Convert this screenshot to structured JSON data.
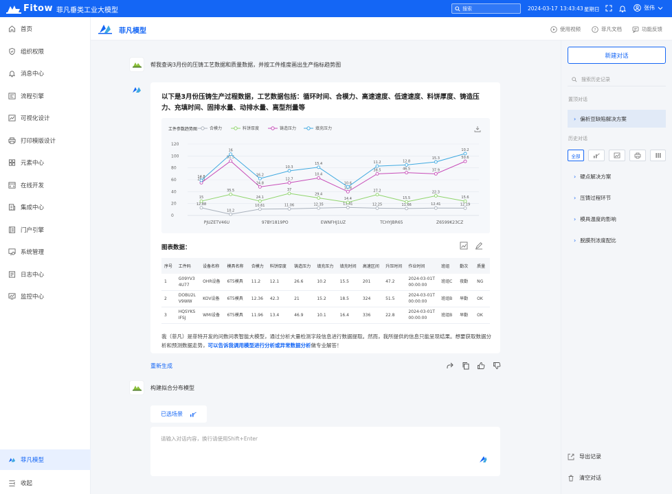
{
  "topbar": {
    "logo_text": "Fitow",
    "app_title": "菲凡垂类工业大模型",
    "search_placeholder": "搜索",
    "date": "2024-03-17",
    "time": "13:43:43",
    "weekday": "星期日",
    "username": "张伟"
  },
  "sidebar": {
    "items": [
      {
        "label": "首页",
        "icon": "home-icon"
      },
      {
        "label": "组织权限",
        "icon": "shield-icon"
      },
      {
        "label": "消息中心",
        "icon": "bell-icon"
      },
      {
        "label": "流程引擎",
        "icon": "flow-icon"
      },
      {
        "label": "可视化设计",
        "icon": "chart-line-icon"
      },
      {
        "label": "打印模版设计",
        "icon": "printer-icon"
      },
      {
        "label": "元素中心",
        "icon": "grid-icon"
      },
      {
        "label": "在线开发",
        "icon": "code-icon"
      },
      {
        "label": "集成中心",
        "icon": "integration-icon"
      },
      {
        "label": "门户引擎",
        "icon": "portal-icon"
      },
      {
        "label": "系统管理",
        "icon": "system-icon"
      },
      {
        "label": "日志中心",
        "icon": "log-icon"
      },
      {
        "label": "监控中心",
        "icon": "monitor-icon"
      }
    ],
    "active_item": "菲凡模型",
    "collapse_label": "收起"
  },
  "header": {
    "title": "菲凡模型",
    "links": [
      "使用视频",
      "菲凡文档",
      "功能反馈"
    ]
  },
  "chat": {
    "user_msg_1": "帮我查询3月份的压铸工艺数据和质量数据，并按工件维度画出生产指标趋势图",
    "answer_intro": "以下是3月份压铸生产过程数据，工艺数据包括：循环时间、合模力、高速速度、低速速度、料饼厚度、铸造压力、充填时间、固排水量、动排水量、离型剂量等",
    "table_title": "图表数据：",
    "answer_tail_1": "我（菲凡）是菲特开发的问数问表智能大模型，通过分析大量检测字段信息进行数据提取。然而，我所提供的信息只能呈现结果。想要获取数据分析和预测数据走势，",
    "answer_tail_link": "可以告诉我调用模型进行分析或异常数据分析",
    "answer_tail_2": "做专业解答！",
    "regenerate": "重新生成",
    "user_msg_2": "构建拟合分布模型",
    "scene_label": "已选场景",
    "input_placeholder": "请输入对话内容，换行请使用Shift+Enter"
  },
  "table": {
    "headers": [
      "序号",
      "工件码",
      "设备名称",
      "模具名称",
      "合模力",
      "料饼厚度",
      "铸造压力",
      "填充压力",
      "填充时间",
      "高速区间",
      "升压时间",
      "作业时间",
      "班组",
      "勤次",
      "质量"
    ],
    "rows": [
      [
        "1",
        "G09YV3 4U77",
        "OHR设备",
        "6T5模具",
        "11.2",
        "12.1",
        "26.6",
        "10.2",
        "15.5",
        "201",
        "47.2",
        "2024-03-01T 00:00:00",
        "班组C",
        "夜勤",
        "NG"
      ],
      [
        "2",
        "DOBU2L V9WW",
        "KOV设备",
        "6T5模具",
        "12.36",
        "42.3",
        "21",
        "15.2",
        "18.5",
        "324",
        "51.5",
        "2024-03-01T 00:00:00",
        "班组B",
        "早勤",
        "OK"
      ],
      [
        "3",
        "HQSYKS IFSJ",
        "WMI设备",
        "6T5模具",
        "11.96",
        "13.4",
        "46.9",
        "10.1",
        "16.4",
        "336",
        "22.8",
        "2024-03-01T 00:00:00",
        "班组B",
        "早勤",
        "OK"
      ]
    ]
  },
  "right": {
    "new_chat": "新建对话",
    "search_placeholder": "搜索历史记录",
    "pinned_label": "置顶对话",
    "pinned_item": "偏析豆缺陷解决方案",
    "history_label": "历史对话",
    "filter_all": "全部",
    "history_items": [
      "硬点解决方案",
      "压铸过程环节",
      "模具温度的影响",
      "脱膜剂浓度配比"
    ],
    "export": "导出记录",
    "clear": "清空对话"
  },
  "chart_data": {
    "type": "line",
    "title": "工件参数趋势图",
    "categories": [
      "PJUZETV46U",
      "97BY1819PO",
      "EWNFHJ1UZ",
      "TCHYJBR65",
      "Z6599K23CZ"
    ],
    "x_points": 9,
    "ylim": [
      0,
      120
    ],
    "yticks": [
      0,
      20,
      40,
      60,
      80,
      100,
      120
    ],
    "series": [
      {
        "name": "合模力",
        "color": "#a9b1bc",
        "values": [
          12.88,
          10.2,
          10.61,
          11.06,
          12.35,
          13.41,
          12.25,
          11.66,
          12.41,
          12.19
        ]
      },
      {
        "name": "料饼厚度",
        "color": "#8fd46b",
        "values": [
          15,
          25.5,
          24.1,
          37,
          29.4,
          14.4,
          27.2,
          15.5,
          22.3,
          15.6
        ]
      },
      {
        "name": "铸造压力",
        "color": "#c74db8",
        "values": [
          25.5,
          91.5,
          24.8,
          12.7,
          10.4,
          16.8,
          38.5,
          46.5,
          37.9,
          50.6
        ]
      },
      {
        "name": "填充压力",
        "color": "#3fa9e0",
        "values": [
          14.8,
          16,
          16.2,
          10.3,
          15.4,
          10.6,
          11.2,
          12.8,
          15.3,
          10.2
        ]
      }
    ],
    "data_labels": {
      "合模力": [
        "12.88",
        "10.2",
        "10.61",
        "11.06",
        "12.35",
        "13.41",
        "12.25",
        "11.66",
        "12.41",
        "12.19"
      ],
      "料饼厚度": [
        "15",
        "35.5",
        "24.1",
        "37",
        "29.4",
        "14.4",
        "27.2",
        "15.5",
        "22.3",
        "15.6"
      ],
      "铸造压力": [
        "25.5",
        "91.5",
        "24.8",
        "12.7",
        "10.4",
        "16.8",
        "38.5",
        "46.5",
        "37.9",
        "50.6"
      ],
      "填充压力": [
        "14.8",
        "16",
        "16.2",
        "10.3",
        "15.4",
        "10.6",
        "11.2",
        "12.8",
        "15.3",
        "10.2"
      ]
    },
    "plot_values": {
      "合模力": [
        12.88,
        2,
        10.61,
        11.06,
        12.35,
        13.41,
        12.25,
        11.66,
        12.41,
        12.19
      ],
      "料饼厚度": [
        24,
        35.5,
        24.1,
        37,
        29.4,
        22,
        35,
        23,
        33,
        24
      ],
      "铸造压力": [
        55,
        91.5,
        48,
        55,
        63,
        40,
        70,
        72,
        70,
        91
      ],
      "填充压力": [
        59,
        103,
        62,
        75,
        81,
        48,
        83,
        85,
        90,
        104
      ]
    },
    "legend_position": "top-left",
    "grid": true
  }
}
